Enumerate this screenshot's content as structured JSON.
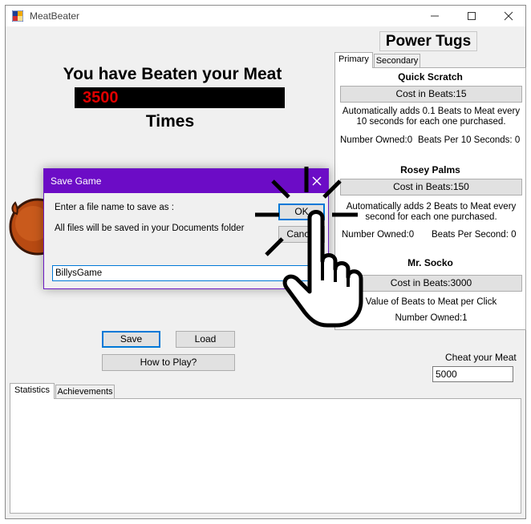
{
  "window": {
    "title": "MeatBeater"
  },
  "main": {
    "headline": "You have Beaten your Meat",
    "count": "3500",
    "times": "Times"
  },
  "power_tugs": {
    "title": "Power Tugs",
    "tabs": [
      {
        "label": "Primary"
      },
      {
        "label": "Secondary"
      }
    ],
    "items": [
      {
        "name": "Quick Scratch",
        "cost": "Cost in Beats:15",
        "desc": "Automatically adds 0.1 Beats to Meat every 10 seconds for each one purchased.",
        "owned": "Number Owned:0",
        "rate": "Beats Per 10 Seconds: 0"
      },
      {
        "name": "Rosey Palms",
        "cost": "Cost in Beats:150",
        "desc": "Automatically adds 2 Beats to Meat every second for each one purchased.",
        "owned": "Number Owned:0",
        "rate": "Beats Per Second: 0"
      },
      {
        "name": "Mr. Socko",
        "cost": "Cost in Beats:3000",
        "desc": "Value of Beats to Meat per Click",
        "owned": "Number Owned:1"
      }
    ]
  },
  "buttons": {
    "save": "Save",
    "load": "Load",
    "how_to_play": "How to Play?"
  },
  "cheat": {
    "label": "Cheat your Meat",
    "value": "5000"
  },
  "bottom_tabs": [
    {
      "label": "Statistics"
    },
    {
      "label": "Achievements"
    }
  ],
  "dialog": {
    "title": "Save Game",
    "prompt": "Enter a file name to save as :",
    "info": "All files will be saved in your Documents folder",
    "ok": "OK",
    "cancel": "Cancel",
    "filename": "BillysGame"
  },
  "colors": {
    "dialog_title": "#6c0cc6",
    "count_text": "#e00000",
    "focus_border": "#0078d7"
  }
}
